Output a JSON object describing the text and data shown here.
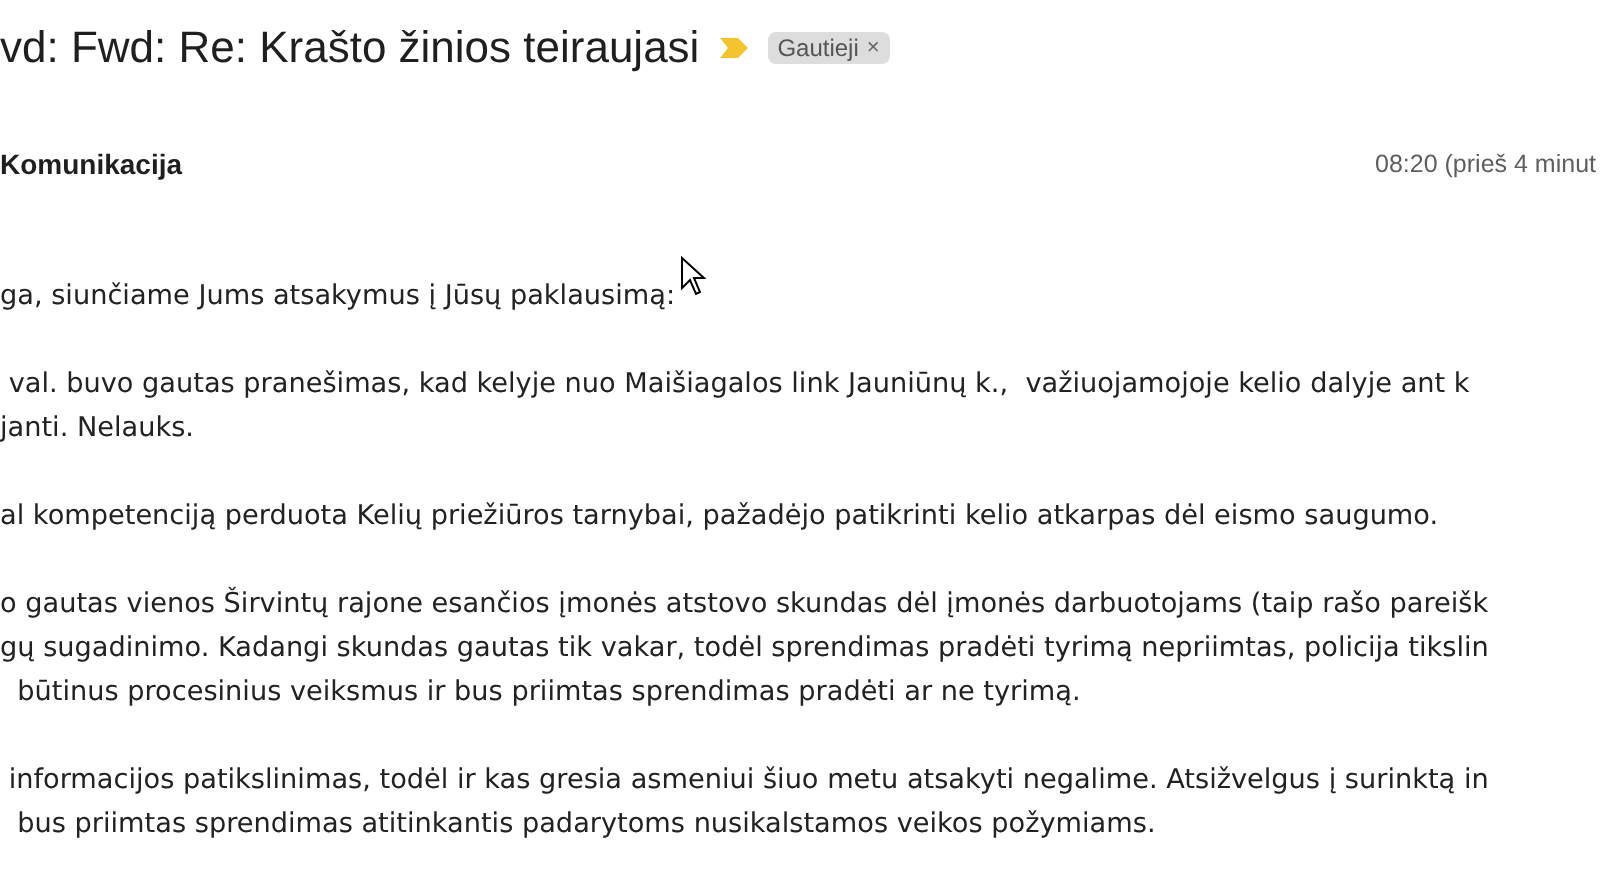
{
  "subject": "vd: Fwd: Re: Krašto žinios teiraujasi",
  "important": true,
  "label": {
    "text": "Gautieji",
    "remove": "×"
  },
  "sender": "Komunikacija",
  "time": "08:20 (prieš 4 minut",
  "paragraphs": [
    [
      "ga, siunčiame Jums atsakymus į Jūsų paklausimą:"
    ],
    [
      " val. buvo gautas pranešimas, kad kelyje nuo Maišiagalos link Jauniūnų k.,  važiuojamojoje kelio dalyje ant k",
      "janti. Nelauks."
    ],
    [
      "al kompetenciją perduota Kelių priežiūros tarnybai, pažadėjo patikrinti kelio atkarpas dėl eismo saugumo."
    ],
    [
      "o gautas vienos Širvintų rajone esančios įmonės atstovo skundas dėl įmonės darbuotojams (taip rašo pareišk",
      "gų sugadinimo. Kadangi skundas gautas tik vakar, todėl sprendimas pradėti tyrimą nepriimtas, policija tikslin",
      "  būtinus procesinius veiksmus ir bus priimtas sprendimas pradėti ar ne tyrimą."
    ],
    [
      " informacijos patikslinimas, todėl ir kas gresia asmeniui šiuo metu atsakyti negalime. Atsižvelgus į surinktą in",
      "  bus priimtas sprendimas atitinkantis padarytoms nusikalstamos veikos požymiams."
    ]
  ]
}
